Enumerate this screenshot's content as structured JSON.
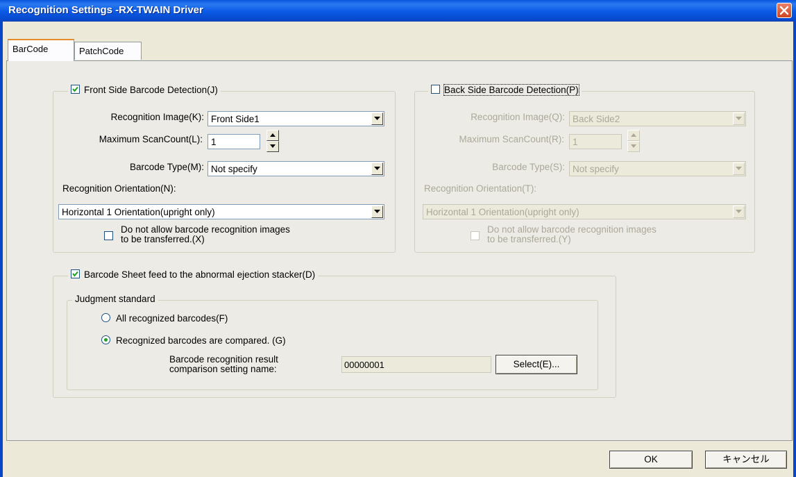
{
  "window": {
    "title": "Recognition Settings -RX-TWAIN Driver",
    "close_icon": "close-icon"
  },
  "tabs": [
    {
      "label": "BarCode",
      "selected": true
    },
    {
      "label": "PatchCode",
      "selected": false
    }
  ],
  "front": {
    "title": "Front Side Barcode Detection(J)",
    "checked": true,
    "recognition_image_label": "Recognition Image(K):",
    "recognition_image_value": "Front Side1",
    "max_scan_label": "Maximum ScanCount(L):",
    "max_scan_value": "1",
    "barcode_type_label": "Barcode Type(M):",
    "barcode_type_value": "Not specify",
    "orientation_label": "Recognition Orientation(N):",
    "orientation_value": "Horizontal 1 Orientation(upright only)",
    "no_transfer_line1": "Do not allow barcode recognition images",
    "no_transfer_line2": "to be transferred.(X)",
    "no_transfer_checked": false
  },
  "back": {
    "title": "Back Side Barcode Detection(P)",
    "checked": false,
    "recognition_image_label": "Recognition Image(Q):",
    "recognition_image_value": "Back Side2",
    "max_scan_label": "Maximum ScanCount(R):",
    "max_scan_value": "1",
    "barcode_type_label": "Barcode Type(S):",
    "barcode_type_value": "Not specify",
    "orientation_label": "Recognition Orientation(T):",
    "orientation_value": "Horizontal 1 Orientation(upright only)",
    "no_transfer_line1": "Do not allow barcode recognition images",
    "no_transfer_line2": "to be transferred.(Y)",
    "no_transfer_checked": false
  },
  "eject": {
    "title": "Barcode Sheet feed to the abnormal ejection stacker(D)",
    "checked": true,
    "judgment_title": "Judgment standard",
    "option_all": "All recognized barcodes(F)",
    "option_compared": "Recognized barcodes are compared. (G)",
    "selected_option": "compared",
    "setting_name_line1": "Barcode recognition result",
    "setting_name_line2": "comparison setting name:",
    "setting_name_value": "00000001",
    "select_button": "Select(E)..."
  },
  "footer": {
    "ok_label": "OK",
    "cancel_label": "キャンセル"
  }
}
